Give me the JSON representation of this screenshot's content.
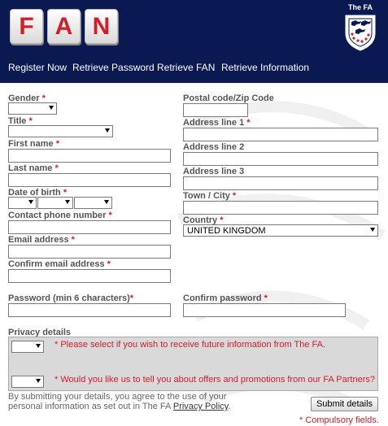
{
  "header": {
    "logo_letters": [
      "F",
      "A",
      "N"
    ],
    "crest_title": "The FA"
  },
  "nav": {
    "items": [
      "Register Now",
      "Retrieve Password",
      "Retrieve FAN",
      "Retrieve Information"
    ]
  },
  "form": {
    "required_mark": "*",
    "gender_label": "Gender",
    "title_label": "Title",
    "first_name_label": "First name",
    "last_name_label": "Last name",
    "dob_label": "Date of birth",
    "phone_label": "Contact phone number",
    "email_label": "Email address",
    "confirm_email_label": "Confirm email address",
    "password_label": "Password (min 6 characters)",
    "postal_code_label": "Postal code/Zip Code",
    "address1_label": "Address line 1",
    "address2_label": "Address line 2",
    "address3_label": "Address line 3",
    "town_label": "Town / City",
    "country_label": "Country",
    "country_value": "UNITED KINGDOM",
    "confirm_password_label": "Confirm password"
  },
  "privacy": {
    "heading": "Privacy details",
    "question1": "* Please select if you wish to receive future information from The FA.",
    "question2": "* Would you like us to tell you about offers and promotions from our FA Partners?"
  },
  "footer": {
    "consent_text": "By submitting your details, you agree to the use of your personal information as set out in The FA",
    "privacy_link": "Privacy Policy",
    "period": ".",
    "submit_label": "Submit details",
    "compulsory_note": "* Compulsory fields."
  },
  "colors": {
    "brand_navy": "#0b1952",
    "accent_red": "#d21d2a"
  }
}
